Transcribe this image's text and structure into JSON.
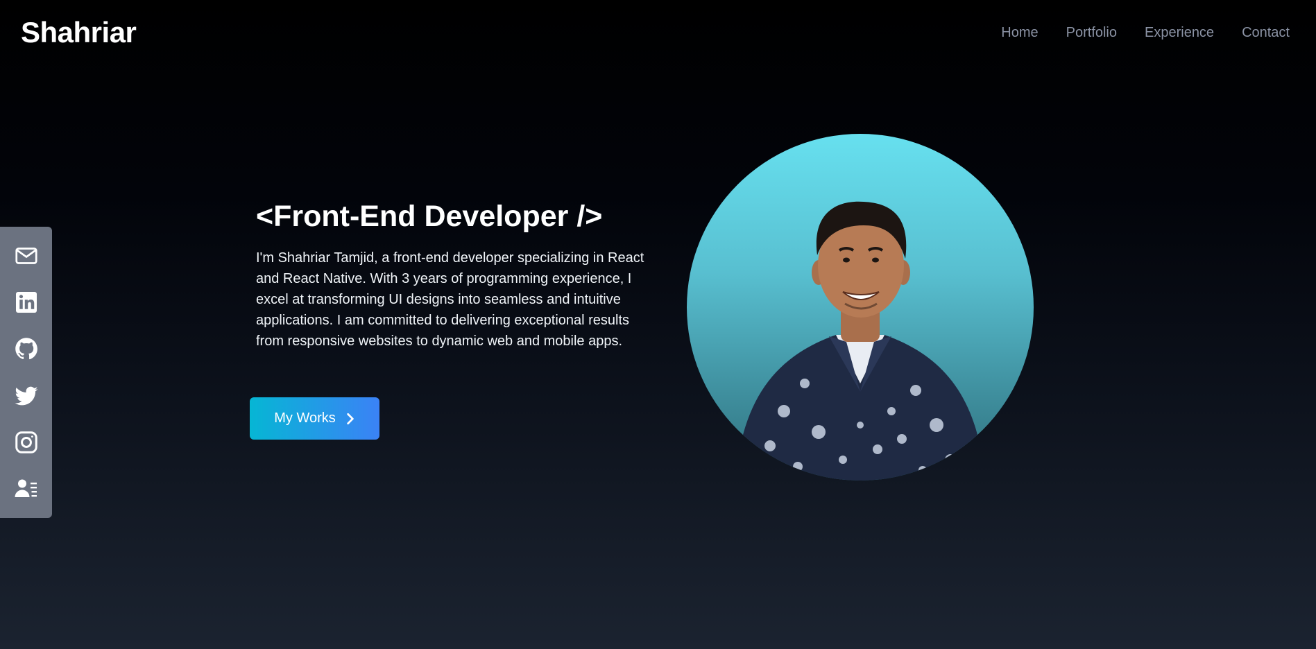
{
  "brand": "Shahriar",
  "nav": {
    "items": [
      {
        "label": "Home"
      },
      {
        "label": "Portfolio"
      },
      {
        "label": "Experience"
      },
      {
        "label": "Contact"
      }
    ]
  },
  "social": {
    "items": [
      {
        "icon": "mail-icon"
      },
      {
        "icon": "linkedin-icon"
      },
      {
        "icon": "github-icon"
      },
      {
        "icon": "twitter-icon"
      },
      {
        "icon": "instagram-icon"
      },
      {
        "icon": "resume-icon"
      }
    ]
  },
  "hero": {
    "title": "<Front-End Developer />",
    "description": "I'm Shahriar Tamjid, a front-end developer specializing in React and React Native. With 3 years of programming experience, I excel at transforming UI designs into seamless and intuitive applications. I am committed to delivering exceptional results from responsive websites to dynamic web and mobile apps.",
    "button_label": "My Works"
  },
  "colors": {
    "accent_start": "#06b6d4",
    "accent_end": "#3b82f6",
    "social_bar": "#6b7280",
    "nav_link": "#8b93a5"
  }
}
